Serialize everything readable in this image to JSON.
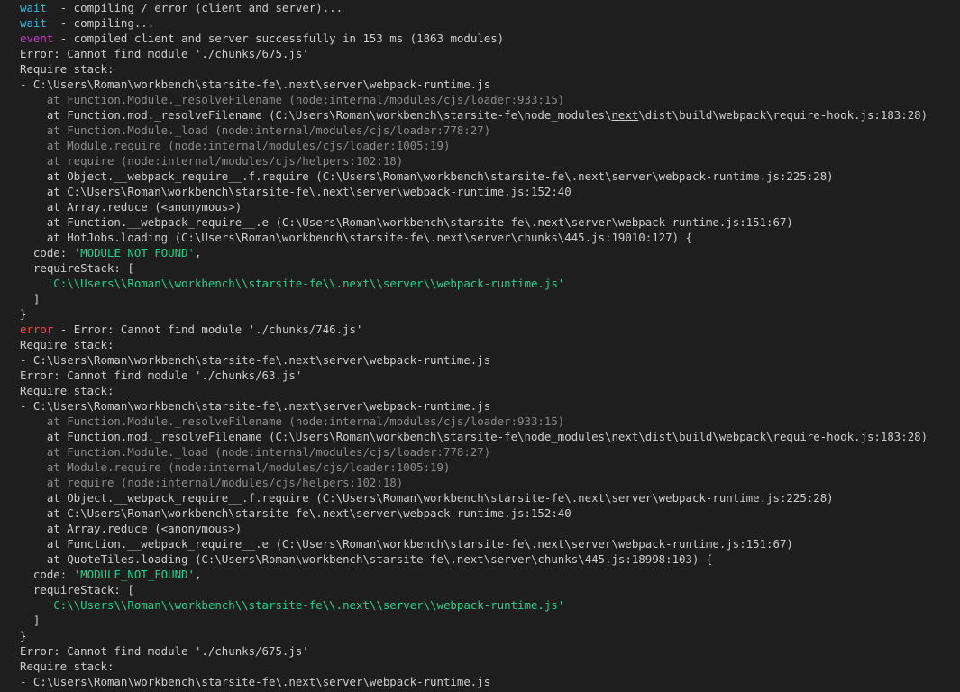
{
  "terminal": {
    "colors": {
      "background": "#1e1e1e",
      "default": "#cccccc",
      "dim": "#8a8a8a",
      "cyan": "#29b8db",
      "magenta": "#bc3fbc",
      "red": "#f14c4c",
      "green": "#23d18b"
    },
    "lines": [
      {
        "segments": [
          {
            "text": "wait",
            "color": "cyan"
          },
          {
            "text": "  - compiling /_error (client and server)...",
            "color": "default"
          }
        ]
      },
      {
        "segments": [
          {
            "text": "wait",
            "color": "cyan"
          },
          {
            "text": "  - compiling...",
            "color": "default"
          }
        ]
      },
      {
        "segments": [
          {
            "text": "event",
            "color": "magenta"
          },
          {
            "text": " - compiled client and server successfully in 153 ms (1863 modules)",
            "color": "default"
          }
        ]
      },
      {
        "segments": [
          {
            "text": "Error: Cannot find module './chunks/675.js'",
            "color": "default"
          }
        ]
      },
      {
        "segments": [
          {
            "text": "Require stack:",
            "color": "default"
          }
        ]
      },
      {
        "segments": [
          {
            "text": "- C:\\Users\\Roman\\workbench\\starsite-fe\\.next\\server\\webpack-runtime.js",
            "color": "default"
          }
        ]
      },
      {
        "segments": [
          {
            "text": "    at Function.Module._resolveFilename (node:internal/modules/cjs/loader:933:15)",
            "color": "dim"
          }
        ]
      },
      {
        "segments": [
          {
            "text": "    at Function.mod._resolveFilename (C:\\Users\\Roman\\workbench\\starsite-fe\\node_modules\\",
            "color": "default"
          },
          {
            "text": "next",
            "color": "default",
            "underline": true
          },
          {
            "text": "\\dist\\build\\webpack\\require-hook.js:183:28)",
            "color": "default"
          }
        ]
      },
      {
        "segments": [
          {
            "text": "    at Function.Module._load (node:internal/modules/cjs/loader:778:27)",
            "color": "dim"
          }
        ]
      },
      {
        "segments": [
          {
            "text": "    at Module.require (node:internal/modules/cjs/loader:1005:19)",
            "color": "dim"
          }
        ]
      },
      {
        "segments": [
          {
            "text": "    at require (node:internal/modules/cjs/helpers:102:18)",
            "color": "dim"
          }
        ]
      },
      {
        "segments": [
          {
            "text": "    at Object.__webpack_require__.f.require (C:\\Users\\Roman\\workbench\\starsite-fe\\.next\\server\\webpack-runtime.js:225:28)",
            "color": "default"
          }
        ]
      },
      {
        "segments": [
          {
            "text": "    at C:\\Users\\Roman\\workbench\\starsite-fe\\.next\\server\\webpack-runtime.js:152:40",
            "color": "default"
          }
        ]
      },
      {
        "segments": [
          {
            "text": "    at Array.reduce (<anonymous>)",
            "color": "default"
          }
        ]
      },
      {
        "segments": [
          {
            "text": "    at Function.__webpack_require__.e (C:\\Users\\Roman\\workbench\\starsite-fe\\.next\\server\\webpack-runtime.js:151:67)",
            "color": "default"
          }
        ]
      },
      {
        "segments": [
          {
            "text": "    at HotJobs.loading (C:\\Users\\Roman\\workbench\\starsite-fe\\.next\\server\\chunks\\445.js:19010:127) {",
            "color": "default"
          }
        ]
      },
      {
        "segments": [
          {
            "text": "  code: ",
            "color": "default"
          },
          {
            "text": "'MODULE_NOT_FOUND'",
            "color": "green"
          },
          {
            "text": ",",
            "color": "default"
          }
        ]
      },
      {
        "segments": [
          {
            "text": "  requireStack: [",
            "color": "default"
          }
        ]
      },
      {
        "segments": [
          {
            "text": "    ",
            "color": "default"
          },
          {
            "text": "'C:\\\\Users\\\\Roman\\\\workbench\\\\starsite-fe\\\\.next\\\\server\\\\webpack-runtime.js'",
            "color": "green"
          }
        ]
      },
      {
        "segments": [
          {
            "text": "  ]",
            "color": "default"
          }
        ]
      },
      {
        "segments": [
          {
            "text": "}",
            "color": "default"
          }
        ]
      },
      {
        "segments": [
          {
            "text": "error",
            "color": "red"
          },
          {
            "text": " - Error: Cannot find module './chunks/746.js'",
            "color": "default"
          }
        ]
      },
      {
        "segments": [
          {
            "text": "Require stack:",
            "color": "default"
          }
        ]
      },
      {
        "segments": [
          {
            "text": "- C:\\Users\\Roman\\workbench\\starsite-fe\\.next\\server\\webpack-runtime.js",
            "color": "default"
          }
        ]
      },
      {
        "segments": [
          {
            "text": "Error: Cannot find module './chunks/63.js'",
            "color": "default"
          }
        ]
      },
      {
        "segments": [
          {
            "text": "Require stack:",
            "color": "default"
          }
        ]
      },
      {
        "segments": [
          {
            "text": "- C:\\Users\\Roman\\workbench\\starsite-fe\\.next\\server\\webpack-runtime.js",
            "color": "default"
          }
        ]
      },
      {
        "segments": [
          {
            "text": "    at Function.Module._resolveFilename (node:internal/modules/cjs/loader:933:15)",
            "color": "dim"
          }
        ]
      },
      {
        "segments": [
          {
            "text": "    at Function.mod._resolveFilename (C:\\Users\\Roman\\workbench\\starsite-fe\\node_modules\\",
            "color": "default"
          },
          {
            "text": "next",
            "color": "default",
            "underline": true
          },
          {
            "text": "\\dist\\build\\webpack\\require-hook.js:183:28)",
            "color": "default"
          }
        ]
      },
      {
        "segments": [
          {
            "text": "    at Function.Module._load (node:internal/modules/cjs/loader:778:27)",
            "color": "dim"
          }
        ]
      },
      {
        "segments": [
          {
            "text": "    at Module.require (node:internal/modules/cjs/loader:1005:19)",
            "color": "dim"
          }
        ]
      },
      {
        "segments": [
          {
            "text": "    at require (node:internal/modules/cjs/helpers:102:18)",
            "color": "dim"
          }
        ]
      },
      {
        "segments": [
          {
            "text": "    at Object.__webpack_require__.f.require (C:\\Users\\Roman\\workbench\\starsite-fe\\.next\\server\\webpack-runtime.js:225:28)",
            "color": "default"
          }
        ]
      },
      {
        "segments": [
          {
            "text": "    at C:\\Users\\Roman\\workbench\\starsite-fe\\.next\\server\\webpack-runtime.js:152:40",
            "color": "default"
          }
        ]
      },
      {
        "segments": [
          {
            "text": "    at Array.reduce (<anonymous>)",
            "color": "default"
          }
        ]
      },
      {
        "segments": [
          {
            "text": "    at Function.__webpack_require__.e (C:\\Users\\Roman\\workbench\\starsite-fe\\.next\\server\\webpack-runtime.js:151:67)",
            "color": "default"
          }
        ]
      },
      {
        "segments": [
          {
            "text": "    at QuoteTiles.loading (C:\\Users\\Roman\\workbench\\starsite-fe\\.next\\server\\chunks\\445.js:18998:103) {",
            "color": "default"
          }
        ]
      },
      {
        "segments": [
          {
            "text": "  code: ",
            "color": "default"
          },
          {
            "text": "'MODULE_NOT_FOUND'",
            "color": "green"
          },
          {
            "text": ",",
            "color": "default"
          }
        ]
      },
      {
        "segments": [
          {
            "text": "  requireStack: [",
            "color": "default"
          }
        ]
      },
      {
        "segments": [
          {
            "text": "    ",
            "color": "default"
          },
          {
            "text": "'C:\\\\Users\\\\Roman\\\\workbench\\\\starsite-fe\\\\.next\\\\server\\\\webpack-runtime.js'",
            "color": "green"
          }
        ]
      },
      {
        "segments": [
          {
            "text": "  ]",
            "color": "default"
          }
        ]
      },
      {
        "segments": [
          {
            "text": "}",
            "color": "default"
          }
        ]
      },
      {
        "segments": [
          {
            "text": "Error: Cannot find module './chunks/675.js'",
            "color": "default"
          }
        ]
      },
      {
        "segments": [
          {
            "text": "Require stack:",
            "color": "default"
          }
        ]
      },
      {
        "segments": [
          {
            "text": "- C:\\Users\\Roman\\workbench\\starsite-fe\\.next\\server\\webpack-runtime.js",
            "color": "default"
          }
        ]
      }
    ]
  }
}
